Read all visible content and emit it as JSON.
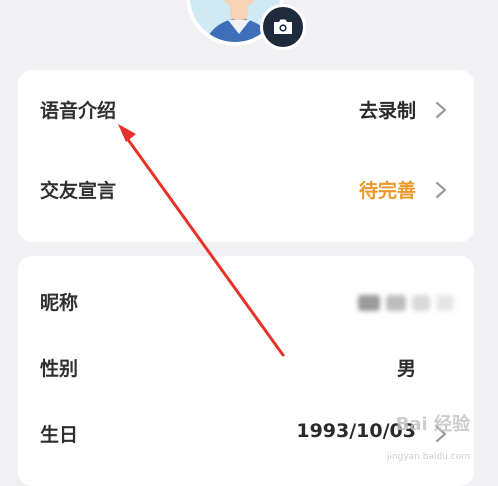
{
  "profile": {
    "avatar_alt": "avatar",
    "camera_icon": "camera-icon"
  },
  "intro_card": {
    "voice_intro": {
      "label": "语音介绍",
      "value": "去录制",
      "icon": "chevron-right-icon"
    },
    "declaration": {
      "label": "交友宣言",
      "value": "待完善",
      "icon": "chevron-right-icon"
    }
  },
  "info_card": {
    "nickname": {
      "label": "昵称"
    },
    "gender": {
      "label": "性别",
      "value": "男"
    },
    "birthday": {
      "label": "生日",
      "value": "1993/10/03",
      "icon": "chevron-right-icon"
    }
  },
  "colors": {
    "accent_orange": "#e9992b",
    "annotation_red": "#e8312a",
    "background": "#f1f1f3"
  },
  "watermark": {
    "text": "Bai 经验",
    "sub": "jingyan.baidu.com"
  }
}
